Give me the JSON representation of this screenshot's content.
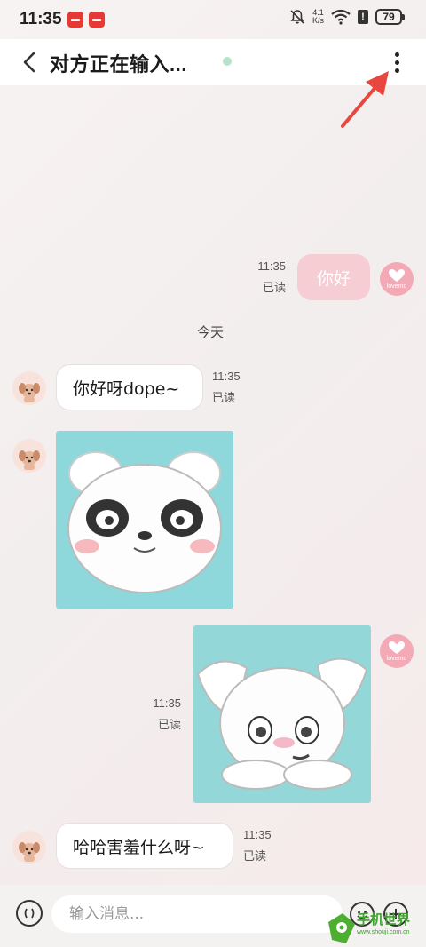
{
  "status_bar": {
    "time": "11:35",
    "net_speed_value": "4.1",
    "net_speed_unit": "K/s",
    "sim_label": "!",
    "battery": "79"
  },
  "header": {
    "title": "对方正在输入...",
    "online_color": "#b8e2c9"
  },
  "messages": [
    {
      "side": "out",
      "type": "text",
      "text": "你好",
      "time": "11:35",
      "status": "已读",
      "avatar": "lovemo"
    },
    {
      "type": "date_separator",
      "text": "今天"
    },
    {
      "side": "in",
      "type": "text",
      "text": "你好呀dope~",
      "time": "11:35",
      "status": "已读",
      "avatar": "dog"
    },
    {
      "side": "in",
      "type": "sticker",
      "sticker": "white-puppy-angry-sticker",
      "avatar": "dog"
    },
    {
      "side": "out",
      "type": "sticker",
      "sticker": "white-puppy-shy-sticker",
      "time": "11:35",
      "status": "已读",
      "avatar": "lovemo"
    },
    {
      "side": "in",
      "type": "text",
      "text": "哈哈害羞什么呀~",
      "time": "11:35",
      "status": "已读",
      "avatar": "dog"
    }
  ],
  "avatars": {
    "lovemo_label": "lovemo"
  },
  "input_bar": {
    "placeholder": "输入消息..."
  },
  "watermark": {
    "text": "手机世界",
    "url": "www.shouji.com.cn"
  },
  "colors": {
    "accent": "#e53935",
    "outgoing_bubble": "#f5cdd3",
    "sticker_bg": "#8ed8dc"
  }
}
